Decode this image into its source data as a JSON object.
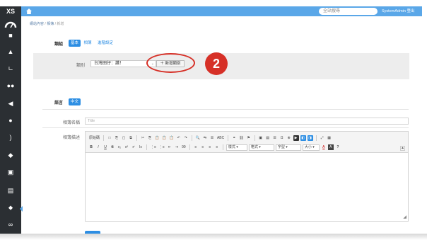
{
  "app": {
    "logo": "XS"
  },
  "header": {
    "search_placeholder": "全站搜尋",
    "user": "SystemAdmin 登出"
  },
  "sidebar": {
    "icons": [
      "gauge-icon",
      "briefcase-icon",
      "lock-icon",
      "sitemap-icon",
      "users-icon",
      "bullhorn-icon",
      "question-icon",
      "rss-icon",
      "graduation-icon",
      "calendar-icon",
      "book-icon",
      "tag-icon",
      "link-icon"
    ]
  },
  "breadcrumb": {
    "items": [
      "網站內容",
      "相簿",
      "新增"
    ],
    "sep": "/"
  },
  "category_section": {
    "label": "類組",
    "tabs": [
      "基本",
      "相簿",
      "進階設定"
    ],
    "field_label": "類別",
    "select_value": "台灣田仔：讚！",
    "add_button": "＋ 新增類別"
  },
  "annotation": {
    "step": "2"
  },
  "language_section": {
    "label": "語言",
    "tab": "中文"
  },
  "name_field": {
    "label": "相簿名稱",
    "placeholder": "Title"
  },
  "desc_field": {
    "label": "相簿描述"
  },
  "editor": {
    "row1": [
      "原始碼",
      "□",
      "⎘",
      "▢",
      "⧉",
      "✂",
      "⎘",
      "📋",
      "📋",
      "📋",
      "↶",
      "↷",
      "🔍",
      "⇆",
      "☰",
      "ABC",
      "⚭",
      "⛓",
      "⚑",
      "▣",
      "▤",
      "☰",
      "Ω",
      "⊕",
      "▶",
      "◧",
      "◨",
      "⤢",
      "▦"
    ],
    "row2": [
      "B",
      "I",
      "U",
      "S",
      "x₂",
      "x²",
      "✔",
      "Ix",
      "⋮≡",
      "⋮≡",
      "⇤",
      "⇥",
      "99",
      "≡",
      "≡",
      "≡",
      "≡"
    ],
    "dropdowns": [
      "樣式",
      "格式",
      "字型",
      "大小"
    ],
    "extra": [
      "A",
      "A",
      "?"
    ]
  },
  "colors": {
    "topbar": "#5aa7e8",
    "sidebar": "#2b2f33",
    "accent": "#2d8ee3",
    "annotation": "#d63027"
  }
}
